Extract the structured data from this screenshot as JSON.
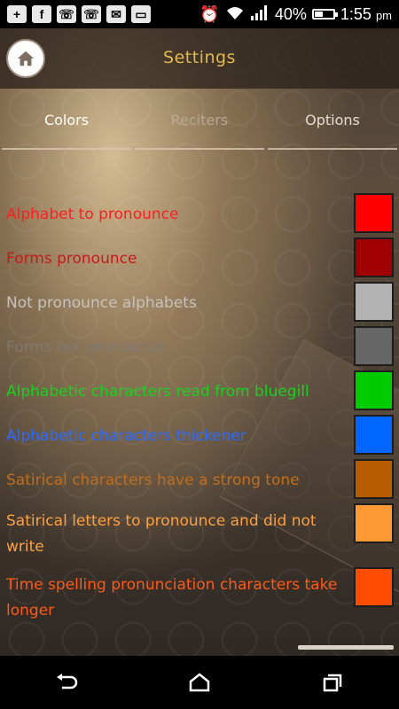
{
  "status_bar": {
    "battery_percent": "40%",
    "time": "1:55",
    "ampm": "pm",
    "icons": [
      "add-icon",
      "facebook-icon",
      "phone-icon",
      "phone-icon",
      "messenger-icon",
      "image-icon",
      "alarm-icon",
      "wifi-icon",
      "signal-icon",
      "battery-icon"
    ]
  },
  "header": {
    "title": "Settings",
    "home_icon": "home-icon"
  },
  "tabs": [
    {
      "label": "Colors",
      "state": "active"
    },
    {
      "label": "Reciters",
      "state": "dim"
    },
    {
      "label": "Options",
      "state": "normal"
    }
  ],
  "color_items": [
    {
      "label": "Alphabet to pronounce",
      "text_color": "#ff1e1e",
      "swatch": "#ff0000"
    },
    {
      "label": "Forms pronounce",
      "text_color": "#c81a1a",
      "swatch": "#a00000"
    },
    {
      "label": "Not pronounce alphabets",
      "text_color": "#c6c2bd",
      "swatch": "#b3b3b3"
    },
    {
      "label": "Forms not pronounce",
      "text_color": "#7e7a75",
      "swatch": "#666666"
    },
    {
      "label": "Alphabetic characters read from bluegill",
      "text_color": "#19d11e",
      "swatch": "#00cc00"
    },
    {
      "label": "Alphabetic characters thickener",
      "text_color": "#2b6bff",
      "swatch": "#0066ff"
    },
    {
      "label": "Satirical characters have a strong tone",
      "text_color": "#c26d1c",
      "swatch": "#b85c00"
    },
    {
      "label": "Satirical letters to pronounce and did not write",
      "text_color": "#ffa040",
      "swatch": "#ff9933"
    },
    {
      "label": "Time spelling pronunciation characters take longer",
      "text_color": "#ff5a14",
      "swatch": "#ff4d00"
    }
  ],
  "navbar": {
    "icons": [
      "back-icon",
      "home-icon",
      "recents-icon"
    ]
  }
}
